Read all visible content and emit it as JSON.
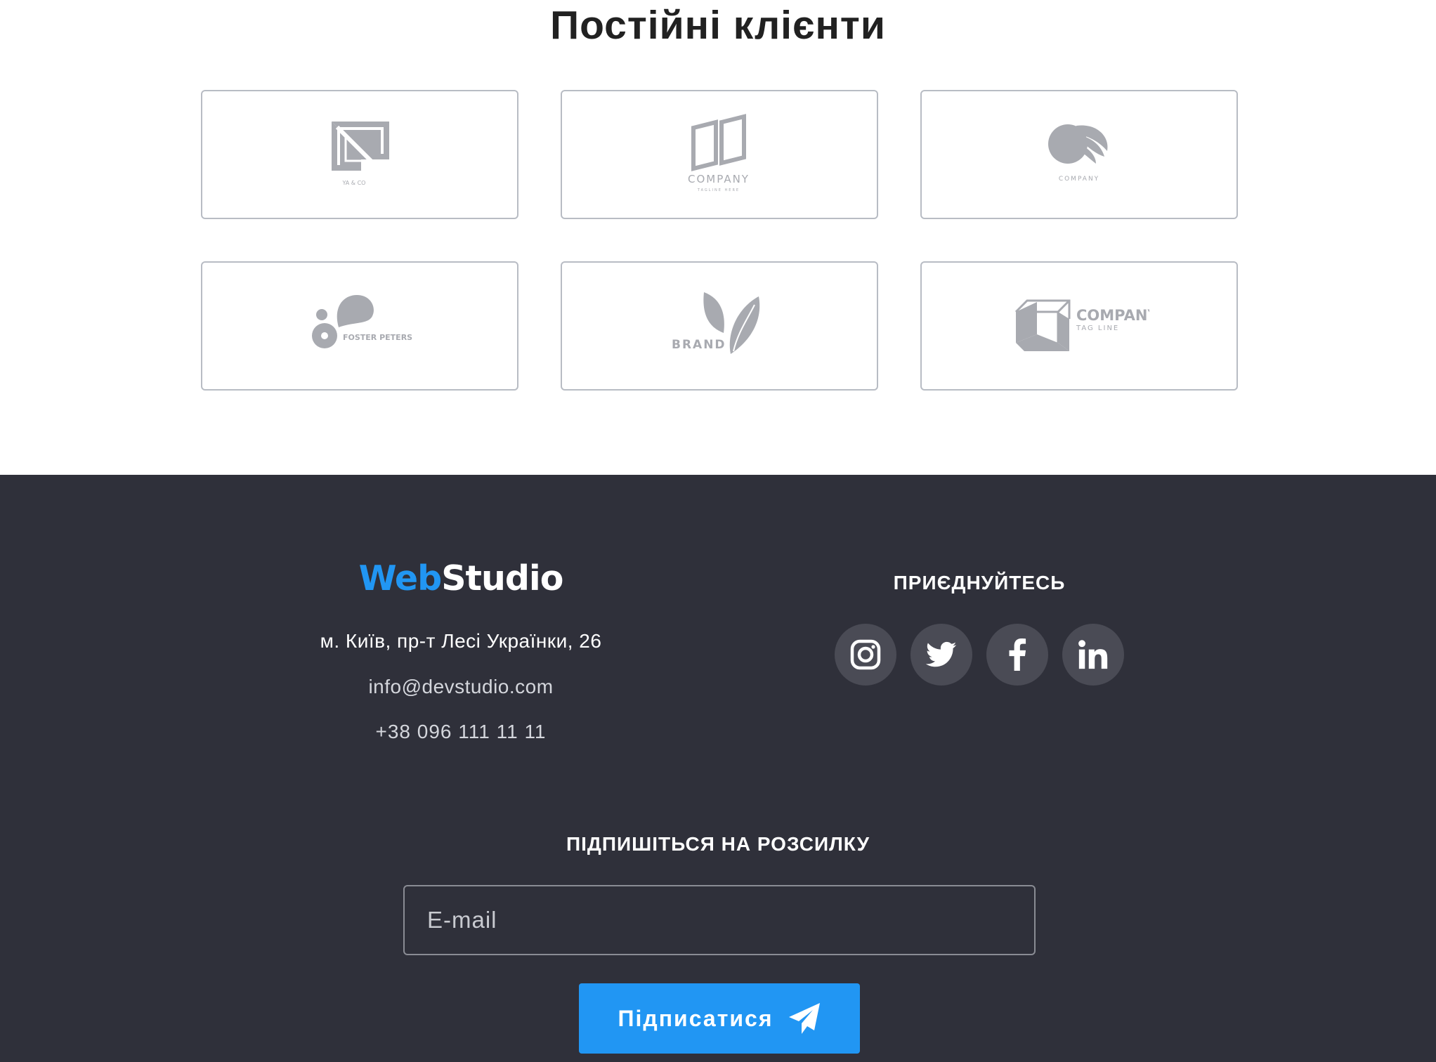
{
  "clients": {
    "title": "Постійні клієнти",
    "logos": [
      {
        "name": "ya-co",
        "text": "YA & CO"
      },
      {
        "name": "company-book",
        "text": "COMPANY",
        "tagline": "TAGLINE HERE"
      },
      {
        "name": "company-leaf",
        "text": "COMPANY"
      },
      {
        "name": "foster-peters",
        "text": "FOSTER PETERS"
      },
      {
        "name": "brand",
        "text": "BRAND"
      },
      {
        "name": "company-box",
        "text": "COMPANY",
        "tagline": "TAG LINE"
      }
    ]
  },
  "footer": {
    "brand": {
      "web": "Web",
      "studio": "Studio"
    },
    "address": "м. Київ, пр-т Лесі Українки, 26",
    "email": "info@devstudio.com",
    "phone": "+38 096 111 11 11",
    "join_title": "ПРИЄДНУЙТЕСЬ",
    "social": [
      {
        "icon": "instagram-icon"
      },
      {
        "icon": "twitter-icon"
      },
      {
        "icon": "facebook-icon"
      },
      {
        "icon": "linkedin-icon"
      }
    ],
    "subscribe": {
      "title": "ПІДПИШІТЬСЯ НА РОЗСИЛКУ",
      "email_placeholder": "E-mail",
      "email_value": "",
      "button_label": "Підписатися",
      "button_icon": "send-icon"
    }
  },
  "colors": {
    "accent": "#2196f3",
    "footer_bg": "#2f303a",
    "social_bg": "#4a4b55",
    "logo_gray": "#a8aab0",
    "title": "#212121"
  }
}
